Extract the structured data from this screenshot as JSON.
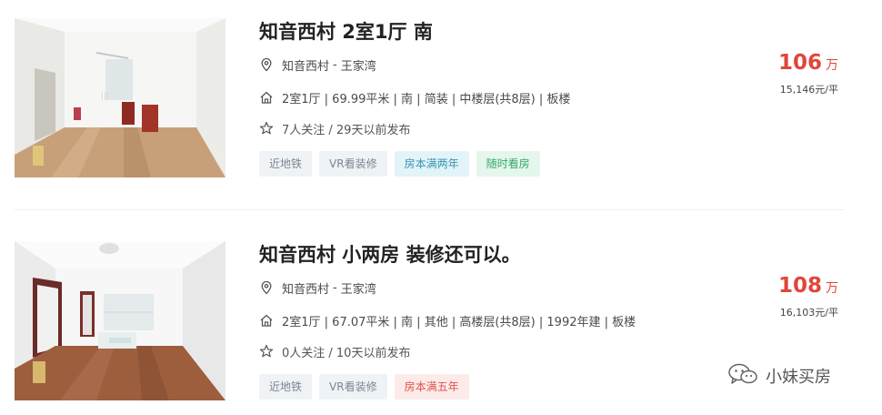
{
  "listings": [
    {
      "title": "知音西村 2室1厅 南",
      "community": "知音西村",
      "area_name": "王家湾",
      "separator": "-",
      "house_info": "2室1厅 | 69.99平米 | 南 | 简装 | 中楼层(共8层) | 板楼",
      "follow_info": "7人关注 / 29天以前发布",
      "tags": [
        "近地铁",
        "VR看装修",
        "房本满两年",
        "随时看房"
      ],
      "total_price": "106",
      "total_unit": "万",
      "unit_price": "15,146元/平"
    },
    {
      "title": "知音西村 小两房 装修还可以。",
      "community": "知音西村",
      "area_name": "王家湾",
      "separator": "-",
      "house_info": "2室1厅 | 67.07平米 | 南 | 其他 | 高楼层(共8层) | 1992年建 | 板楼",
      "follow_info": "0人关注 / 10天以前发布",
      "tags": [
        "近地铁",
        "VR看装修",
        "房本满五年"
      ],
      "total_price": "108",
      "total_unit": "万",
      "unit_price": "16,103元/平"
    }
  ],
  "watermark": {
    "text": "小妹买房"
  },
  "icons": {
    "location": "location-pin-icon",
    "house": "house-icon",
    "follow": "star-icon",
    "watermark": "wechat-icon"
  },
  "colors": {
    "price": "#e0463b",
    "tag_grey": "#7d8590",
    "tag_blue": "#3595b0",
    "tag_green": "#32a86a",
    "tag_red": "#e0524a"
  }
}
